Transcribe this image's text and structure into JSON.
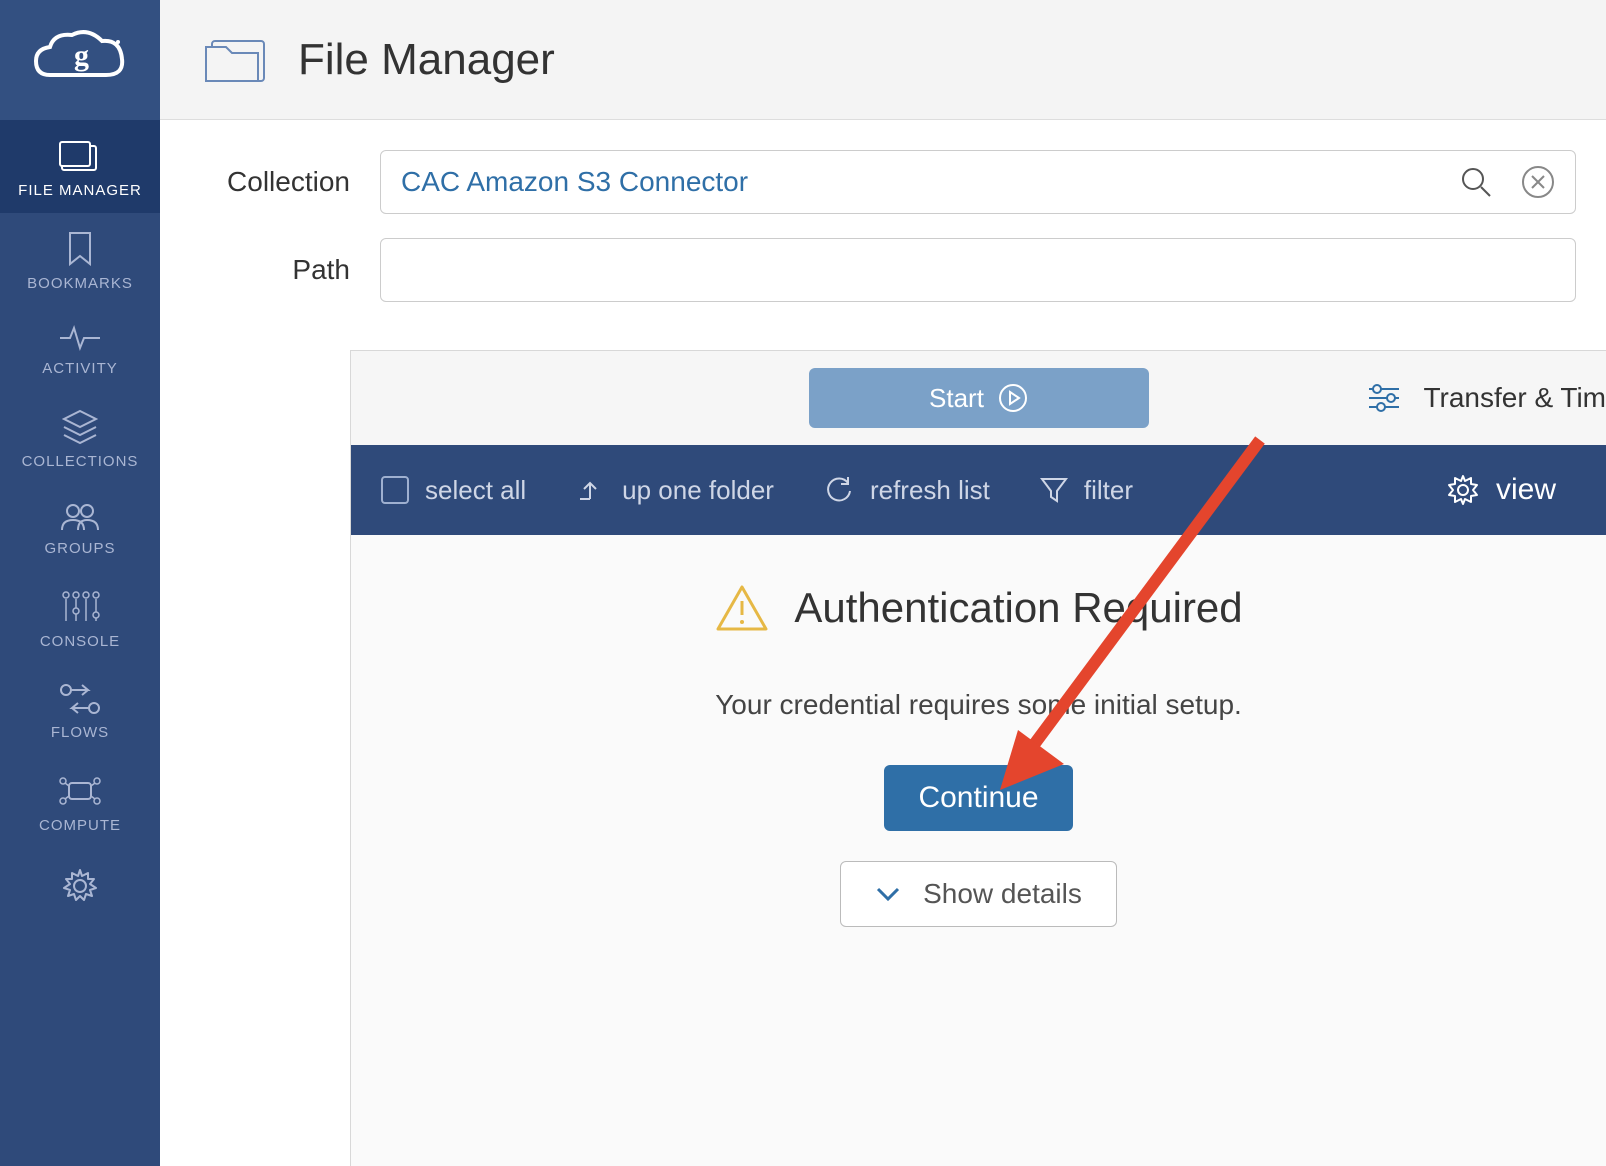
{
  "header": {
    "title": "File Manager"
  },
  "sidebar": {
    "items": [
      {
        "label": "FILE MANAGER"
      },
      {
        "label": "BOOKMARKS"
      },
      {
        "label": "ACTIVITY"
      },
      {
        "label": "COLLECTIONS"
      },
      {
        "label": "GROUPS"
      },
      {
        "label": "CONSOLE"
      },
      {
        "label": "FLOWS"
      },
      {
        "label": "COMPUTE"
      }
    ]
  },
  "fields": {
    "collection_label": "Collection",
    "collection_value": "CAC Amazon S3 Connector",
    "path_label": "Path",
    "path_value": ""
  },
  "start_bar": {
    "start_label": "Start",
    "transfer_label": "Transfer & Tim"
  },
  "toolbar": {
    "select_all": "select all",
    "up_one": "up one folder",
    "refresh": "refresh list",
    "filter": "filter",
    "view": "view"
  },
  "auth": {
    "title": "Authentication Required",
    "message": "Your credential requires some initial setup.",
    "continue_label": "Continue",
    "details_label": "Show details"
  }
}
